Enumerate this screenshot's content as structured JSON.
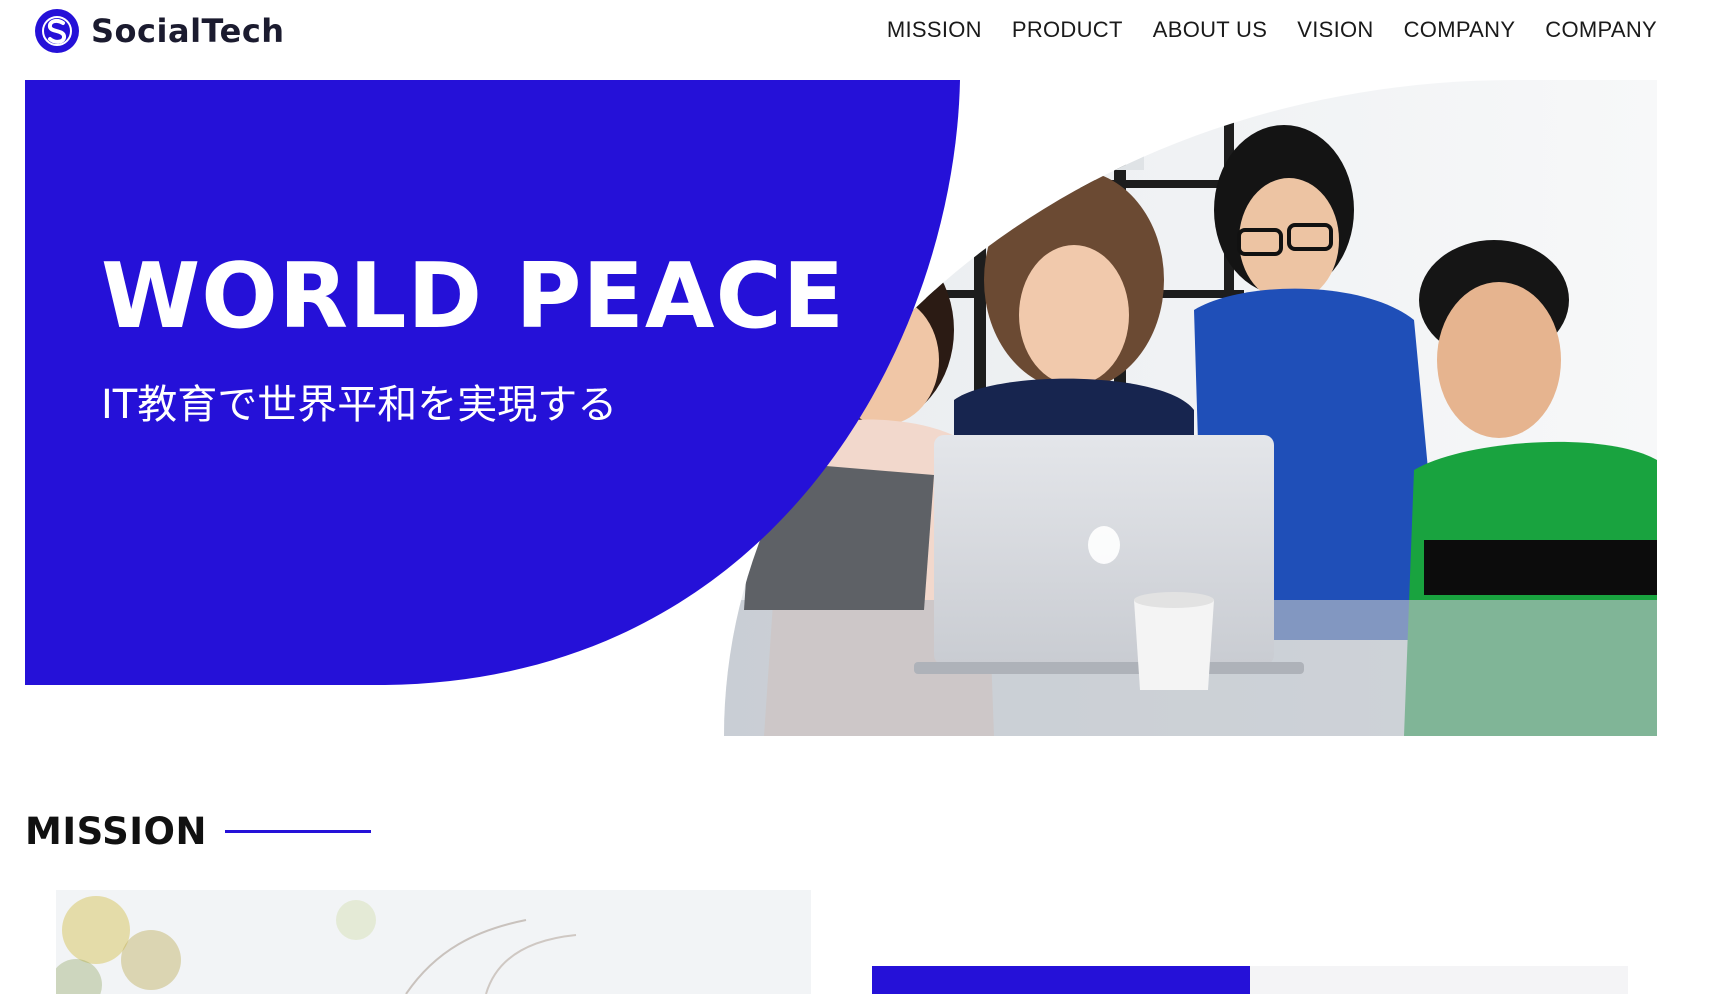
{
  "brand": {
    "name": "SocialTech",
    "logo_letter": "S",
    "accent": "#2511d8"
  },
  "nav": {
    "items": [
      "MISSION",
      "PRODUCT",
      "ABOUT US",
      "VISION",
      "COMPANY",
      "COMPANY"
    ]
  },
  "hero": {
    "title": "WORLD PEACE",
    "subtitle": "IT教育で世界平和を実現する",
    "panel_color": "#2511d8"
  },
  "mission": {
    "heading": "MISSION"
  }
}
